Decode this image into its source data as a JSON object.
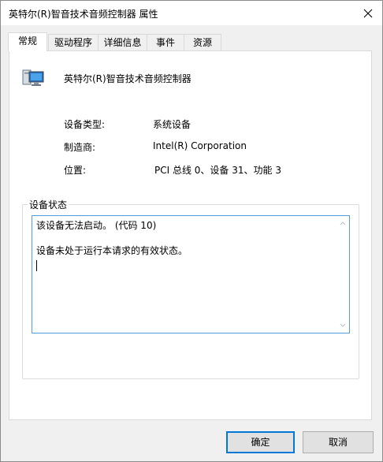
{
  "window": {
    "title": "英特尔(R)智音技术音频控制器 属性"
  },
  "tabs": [
    {
      "label": "常规",
      "active": true
    },
    {
      "label": "驱动程序",
      "active": false
    },
    {
      "label": "详细信息",
      "active": false
    },
    {
      "label": "事件",
      "active": false
    },
    {
      "label": "资源",
      "active": false
    }
  ],
  "general": {
    "device_icon": "monitor-icon",
    "device_name": "英特尔(R)智音技术音频控制器",
    "rows": [
      {
        "label": "设备类型:",
        "value": "系统设备"
      },
      {
        "label": "制造商:",
        "value": "Intel(R) Corporation"
      },
      {
        "label": "位置:",
        "value": "PCI 总线 0、设备 31、功能 3"
      }
    ],
    "status_group_title": "设备状态",
    "status_text": "该设备无法启动。 (代码 10)\n\n设备未处于运行本请求的有效状态。"
  },
  "buttons": {
    "ok": "确定",
    "cancel": "取消"
  },
  "colors": {
    "focus_border": "#0078d7",
    "textbox_border": "#5b9bd5"
  }
}
